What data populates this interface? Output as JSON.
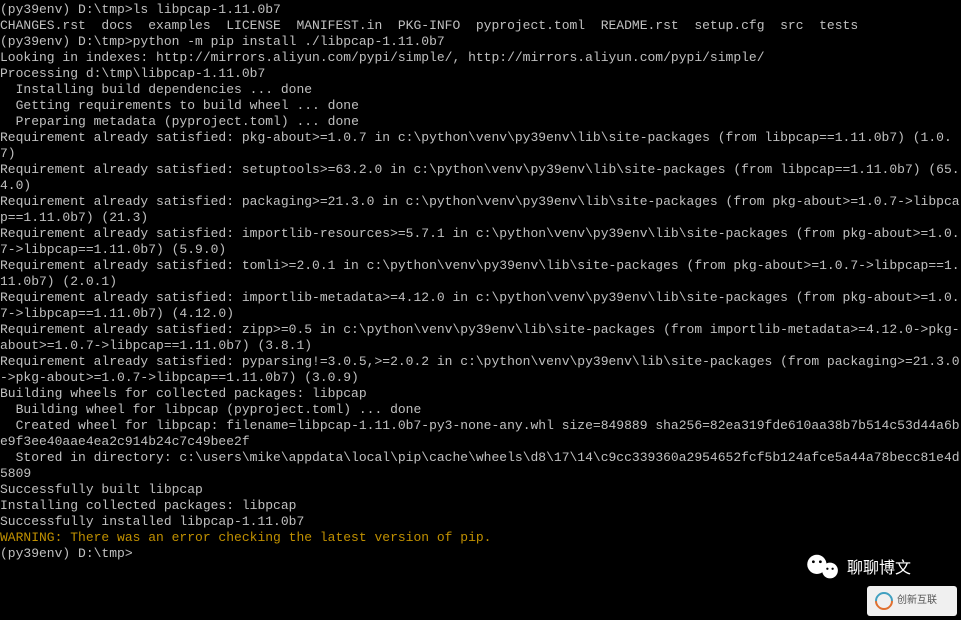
{
  "terminal": {
    "lines": [
      {
        "text": "(py39env) D:\\tmp>ls libpcap-1.11.0b7",
        "cls": ""
      },
      {
        "text": "CHANGES.rst  docs  examples  LICENSE  MANIFEST.in  PKG-INFO  pyproject.toml  README.rst  setup.cfg  src  tests",
        "cls": ""
      },
      {
        "text": "",
        "cls": ""
      },
      {
        "text": "(py39env) D:\\tmp>python -m pip install ./libpcap-1.11.0b7",
        "cls": ""
      },
      {
        "text": "Looking in indexes: http://mirrors.aliyun.com/pypi/simple/, http://mirrors.aliyun.com/pypi/simple/",
        "cls": ""
      },
      {
        "text": "Processing d:\\tmp\\libpcap-1.11.0b7",
        "cls": ""
      },
      {
        "text": "  Installing build dependencies ... done",
        "cls": ""
      },
      {
        "text": "  Getting requirements to build wheel ... done",
        "cls": ""
      },
      {
        "text": "  Preparing metadata (pyproject.toml) ... done",
        "cls": ""
      },
      {
        "text": "Requirement already satisfied: pkg-about>=1.0.7 in c:\\python\\venv\\py39env\\lib\\site-packages (from libpcap==1.11.0b7) (1.0.7)",
        "cls": ""
      },
      {
        "text": "Requirement already satisfied: setuptools>=63.2.0 in c:\\python\\venv\\py39env\\lib\\site-packages (from libpcap==1.11.0b7) (65.4.0)",
        "cls": ""
      },
      {
        "text": "Requirement already satisfied: packaging>=21.3.0 in c:\\python\\venv\\py39env\\lib\\site-packages (from pkg-about>=1.0.7->libpcap==1.11.0b7) (21.3)",
        "cls": ""
      },
      {
        "text": "Requirement already satisfied: importlib-resources>=5.7.1 in c:\\python\\venv\\py39env\\lib\\site-packages (from pkg-about>=1.0.7->libpcap==1.11.0b7) (5.9.0)",
        "cls": ""
      },
      {
        "text": "Requirement already satisfied: tomli>=2.0.1 in c:\\python\\venv\\py39env\\lib\\site-packages (from pkg-about>=1.0.7->libpcap==1.11.0b7) (2.0.1)",
        "cls": ""
      },
      {
        "text": "Requirement already satisfied: importlib-metadata>=4.12.0 in c:\\python\\venv\\py39env\\lib\\site-packages (from pkg-about>=1.0.7->libpcap==1.11.0b7) (4.12.0)",
        "cls": ""
      },
      {
        "text": "Requirement already satisfied: zipp>=0.5 in c:\\python\\venv\\py39env\\lib\\site-packages (from importlib-metadata>=4.12.0->pkg-about>=1.0.7->libpcap==1.11.0b7) (3.8.1)",
        "cls": ""
      },
      {
        "text": "Requirement already satisfied: pyparsing!=3.0.5,>=2.0.2 in c:\\python\\venv\\py39env\\lib\\site-packages (from packaging>=21.3.0->pkg-about>=1.0.7->libpcap==1.11.0b7) (3.0.9)",
        "cls": ""
      },
      {
        "text": "Building wheels for collected packages: libpcap",
        "cls": ""
      },
      {
        "text": "  Building wheel for libpcap (pyproject.toml) ... done",
        "cls": ""
      },
      {
        "text": "  Created wheel for libpcap: filename=libpcap-1.11.0b7-py3-none-any.whl size=849889 sha256=82ea319fde610aa38b7b514c53d44a6be9f3ee40aae4ea2c914b24c7c49bee2f",
        "cls": ""
      },
      {
        "text": "  Stored in directory: c:\\users\\mike\\appdata\\local\\pip\\cache\\wheels\\d8\\17\\14\\c9cc339360a2954652fcf5b124afce5a44a78becc81e4d5809",
        "cls": ""
      },
      {
        "text": "Successfully built libpcap",
        "cls": ""
      },
      {
        "text": "Installing collected packages: libpcap",
        "cls": ""
      },
      {
        "text": "Successfully installed libpcap-1.11.0b7",
        "cls": ""
      },
      {
        "text": "WARNING: There was an error checking the latest version of pip.",
        "cls": "warning"
      },
      {
        "text": "",
        "cls": ""
      },
      {
        "text": "(py39env) D:\\tmp>",
        "cls": ""
      }
    ]
  },
  "watermark1": {
    "label": "聊聊博文"
  },
  "watermark2": {
    "label": "创新互联"
  }
}
